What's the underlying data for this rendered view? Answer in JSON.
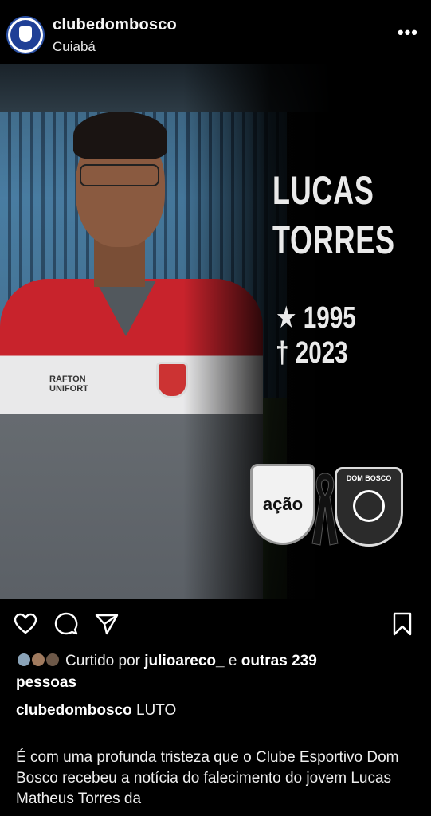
{
  "post_header": {
    "username": "clubedombosco",
    "location": "Cuiabá",
    "more_glyph": "•••"
  },
  "post_image": {
    "name_line1": "LUCAS",
    "name_line2": "TORRES",
    "birth": "★ 1995",
    "death": "† 2023",
    "shirt_brand": "RAFTON\nUNIFORT",
    "logo_left_text": "ação",
    "logo_right_text": "DOM BOSCO"
  },
  "actions": {
    "like_icon": "heart-icon",
    "comment_icon": "comment-icon",
    "share_icon": "share-icon",
    "save_icon": "bookmark-icon"
  },
  "likes": {
    "prefix": "Curtido por",
    "user": "julioareco_",
    "conj": "e",
    "others": "outras 239",
    "suffix": "pessoas"
  },
  "caption": {
    "username": "clubedombosco",
    "title": "LUTO",
    "body": "É com uma profunda tristeza que o Clube Esportivo Dom Bosco recebeu a notícia do falecimento do jovem Lucas Matheus Torres da"
  },
  "colors": {
    "background": "#000000",
    "text": "#f5f5f5",
    "brand_blue": "#1f3f96",
    "shirt_red": "#c8232c"
  }
}
